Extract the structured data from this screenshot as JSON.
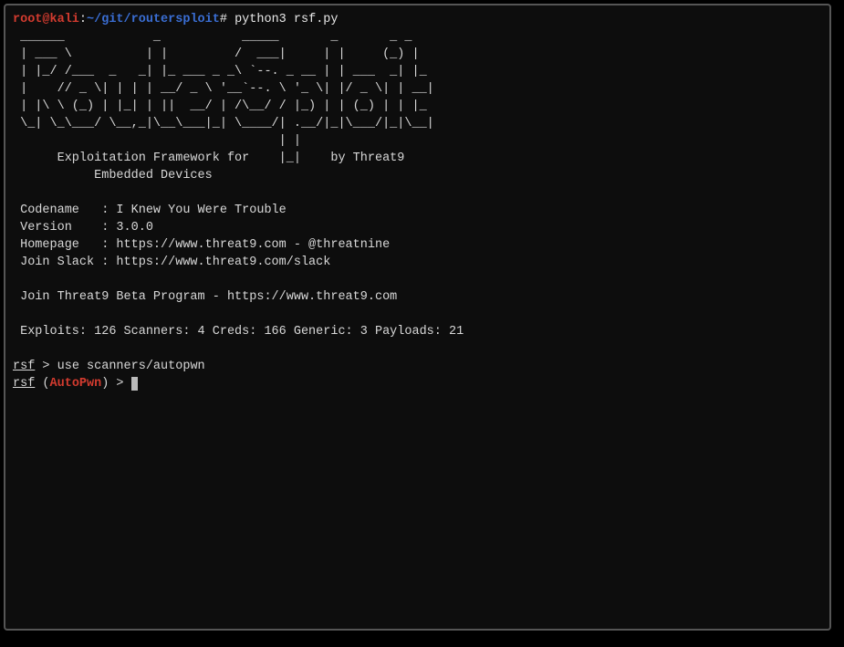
{
  "prompt": {
    "user": "root@kali",
    "sep1": ":",
    "path": "~/git/routersploit",
    "hash": "#",
    "command": "python3 rsf.py"
  },
  "ascii": {
    "l0": " ______            _           _____       _       _ _",
    "l1": " | ___ \\          | |         /  ___|     | |     (_) |",
    "l2": " | |_/ /___  _   _| |_ ___ _ _\\ `--. _ __ | | ___  _| |_",
    "l3": " |    // _ \\| | | | __/ _ \\ '__`--. \\ '_ \\| |/ _ \\| | __|",
    "l4": " | |\\ \\ (_) | |_| | ||  __/ | /\\__/ / |_) | | (_) | | |_",
    "l5": " \\_| \\_\\___/ \\__,_|\\__\\___|_| \\____/| .__/|_|\\___/|_|\\__|",
    "l6": "                                    | |",
    "l7": "      Exploitation Framework for    |_|    by Threat9",
    "l8": "           Embedded Devices"
  },
  "info": {
    "codename": " Codename   : I Knew You Were Trouble",
    "version": " Version    : 3.0.0",
    "homepage": " Homepage   : https://www.threat9.com - @threatnine",
    "slack": " Join Slack : https://www.threat9.com/slack",
    "beta": " Join Threat9 Beta Program - https://www.threat9.com",
    "stats": " Exploits: 126 Scanners: 4 Creds: 166 Generic: 3 Payloads: 21"
  },
  "cmd1": {
    "prompt_ul": "rsf",
    "rest": " > use scanners/autopwn"
  },
  "cmd2": {
    "prompt_ul": "rsf",
    "open": " (",
    "module": "AutoPwn",
    "close": ") > "
  }
}
